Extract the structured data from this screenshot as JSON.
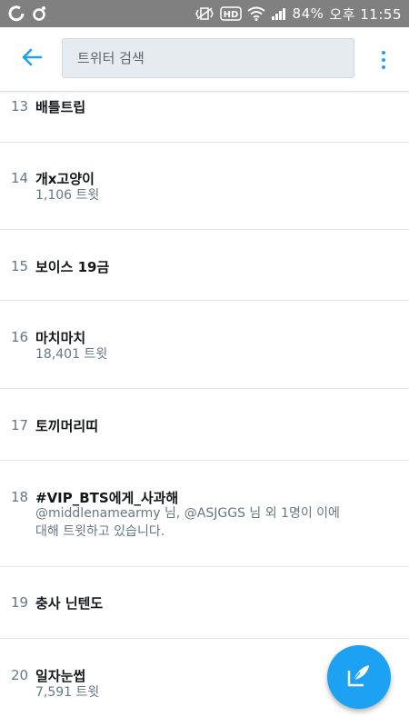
{
  "status_bar": {
    "left_icons": [
      "carrier-o-icon",
      "sync-icon"
    ],
    "right_icons": [
      "vibrate-icon",
      "hd-icon",
      "wifi-icon",
      "signal-icon"
    ],
    "battery": "84%",
    "time": "오후 11:55"
  },
  "header": {
    "search_placeholder": "트위터 검색"
  },
  "trends": [
    {
      "rank": "13",
      "title": "배틀트립",
      "subtitle": ""
    },
    {
      "rank": "14",
      "title": "개x고양이",
      "subtitle": "1,106 트윗"
    },
    {
      "rank": "15",
      "title": "보이스 19금",
      "subtitle": ""
    },
    {
      "rank": "16",
      "title": "마치마치",
      "subtitle": "18,401 트윗"
    },
    {
      "rank": "17",
      "title": "토끼머리띠",
      "subtitle": ""
    },
    {
      "rank": "18",
      "title": "#VIP_BTS에게_사과해",
      "subtitle": "@middlenamearmy 님, @ASJGGS 님 외 1명이 이에",
      "subtitle2": "대해 트윗하고 있습니다."
    },
    {
      "rank": "19",
      "title": "충사 닌텐도",
      "subtitle": ""
    },
    {
      "rank": "20",
      "title": "일자눈썹",
      "subtitle": "7,591 트윗"
    }
  ],
  "colors": {
    "accent": "#1da1f2",
    "status_bar": "#808080"
  }
}
